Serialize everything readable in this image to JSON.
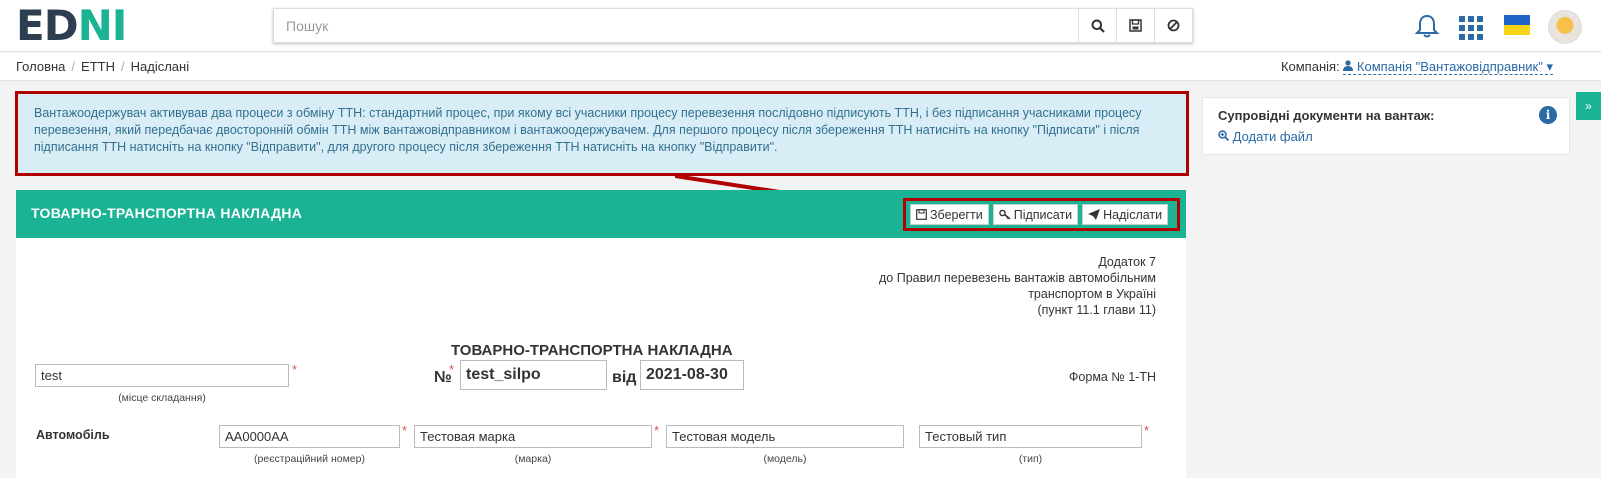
{
  "header": {
    "logo": {
      "part1": "ED",
      "part2": "N",
      "part3": "I"
    },
    "search_placeholder": "Пошук",
    "icons": [
      "search-icon",
      "save-icon",
      "ban-icon",
      "bell-icon",
      "apps-grid-icon",
      "ukraine-flag-icon",
      "avatar"
    ]
  },
  "breadcrumb": {
    "items": [
      "Головна",
      "ЕТТН",
      "Надіслані"
    ]
  },
  "company": {
    "label": "Компанія:",
    "value": "Компанія \"Вантажовідправник\""
  },
  "alert": {
    "text": "Вантажоодержувач активував два процеси з обміну ТТН: стандартний процес, при якому всі учасники процесу перевезення послідовно підписують ТТН, і без підписання учасниками процесу перевезення, який передбачає двосторонній обмін ТТН між вантажовідправником і вантажоодержувачем. Для першого процесу після збереження ТТН натисніть на кнопку \"Підписати\" і після підписання ТТН натисніть на кнопку \"Відправити\", для другого процесу після збереження ТТН натисніть на кнопку \"Відправити\"."
  },
  "doc": {
    "header_title": "ТОВАРНО-ТРАНСПОРТНА НАКЛАДНА",
    "buttons": {
      "save": "Зберегти",
      "sign": "Підписати",
      "send": "Надіслати"
    },
    "annex": [
      "Додаток 7",
      "до Правил перевезень вантажів автомобільним",
      "транспортом в Україні",
      "(пункт 11.1 глави 11)"
    ],
    "title": "ТОВАРНО-ТРАНСПОРТНА НАКЛАДНА",
    "place": {
      "value": "test",
      "caption": "(місце складання)"
    },
    "number": {
      "label": "№",
      "value": "test_silpo"
    },
    "date": {
      "label": "від",
      "value": "2021-08-30"
    },
    "form": "Форма № 1-ТН",
    "vehicle": {
      "label": "Автомобіль",
      "reg": {
        "value": "AA0000AA",
        "caption": "(реєстраційний номер)"
      },
      "brand": {
        "value": "Тестовая марка",
        "caption": "(марка)"
      },
      "model": {
        "value": "Тестовая модель",
        "caption": "(модель)"
      },
      "type": {
        "value": "Тестовый тип",
        "caption": "(тип)"
      }
    }
  },
  "side": {
    "title": "Супровідні документи на вантаж:",
    "add_file": "Додати файл",
    "toggle": "»"
  },
  "colors": {
    "accent": "#1ab394",
    "highlight": "#b00000",
    "link": "#2a6aa5",
    "alert_bg": "#d9edf7"
  }
}
